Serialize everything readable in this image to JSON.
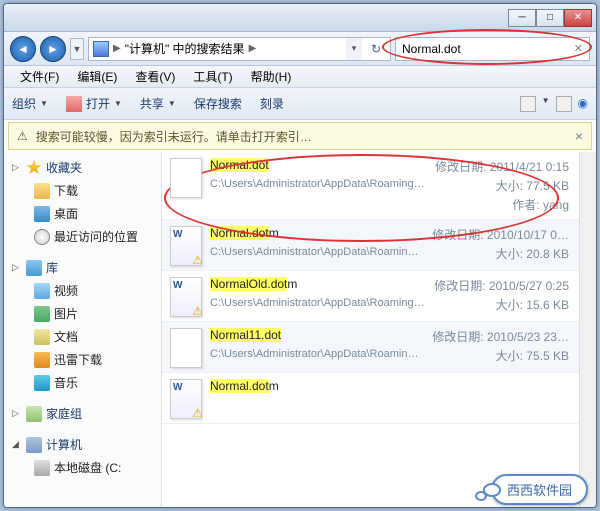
{
  "addressbar": {
    "segment1": "\"计算机\" 中的搜索结果",
    "segment2": ""
  },
  "search": {
    "value": "Normal.dot"
  },
  "menubar": {
    "file": "文件(F)",
    "edit": "编辑(E)",
    "view": "查看(V)",
    "tools": "工具(T)",
    "help": "帮助(H)"
  },
  "toolbar": {
    "organize": "组织",
    "open": "打开",
    "share": "共享",
    "save_search": "保存搜索",
    "burn": "刻录"
  },
  "infobar": {
    "text": "搜索可能较慢，因为索引未运行。请单击打开索引…",
    "close": "×"
  },
  "sidebar": {
    "favorites": {
      "label": "收藏夹",
      "items": [
        {
          "label": "下载",
          "icon": "ic-folder"
        },
        {
          "label": "桌面",
          "icon": "ic-desktop"
        },
        {
          "label": "最近访问的位置",
          "icon": "ic-clock"
        }
      ]
    },
    "libraries": {
      "label": "库",
      "items": [
        {
          "label": "视频",
          "icon": "ic-video"
        },
        {
          "label": "图片",
          "icon": "ic-pic"
        },
        {
          "label": "文档",
          "icon": "ic-doc"
        },
        {
          "label": "迅雷下载",
          "icon": "ic-thunder"
        },
        {
          "label": "音乐",
          "icon": "ic-music"
        }
      ]
    },
    "homegroup": {
      "label": "家庭组"
    },
    "computer": {
      "label": "计算机",
      "items": [
        {
          "label": "本地磁盘 (C:",
          "icon": "ic-drive"
        }
      ]
    }
  },
  "meta_labels": {
    "modified": "修改日期:",
    "size": "大小:",
    "author": "作者:"
  },
  "results": [
    {
      "name_hl": "Normal.dot",
      "name_rest": "",
      "thumb": "",
      "modified": "2011/4/21 0:15",
      "size": "77.5 KB",
      "author": "yang",
      "path": "C:\\Users\\Administrator\\AppData\\Roaming\\Microsoft\\Templates",
      "alt": false
    },
    {
      "name_hl": "Normal.dot",
      "name_rest": "m",
      "thumb": "word warn",
      "modified": "2010/10/17 0…",
      "size": "20.8 KB",
      "author": "",
      "path": "C:\\Users\\Administrator\\AppData\\Roaming\\Microsoft\\Templates",
      "alt": true
    },
    {
      "name_hl_a": "NormalOld.",
      "name_hl_b": "dot",
      "name_rest": "m",
      "split": true,
      "thumb": "word warn",
      "modified": "2010/5/27 0:25",
      "size": "15.6 KB",
      "author": "",
      "path": "C:\\Users\\Administrator\\AppData\\Roaming\\Microsoft\\Templates",
      "alt": false
    },
    {
      "name_hl": "Normal11.dot",
      "name_rest": "",
      "thumb": "",
      "modified": "2010/5/23 23…",
      "size": "75.5 KB",
      "author": "",
      "path": "C:\\Users\\Administrator\\AppData\\Roaming\\Microsoft\\Templates",
      "alt": true
    },
    {
      "name_hl": "Normal.dot",
      "name_rest": "m",
      "thumb": "word warn",
      "modified": "",
      "size": "",
      "author": "",
      "path": "",
      "alt": false
    }
  ],
  "watermark": "西西软件园"
}
